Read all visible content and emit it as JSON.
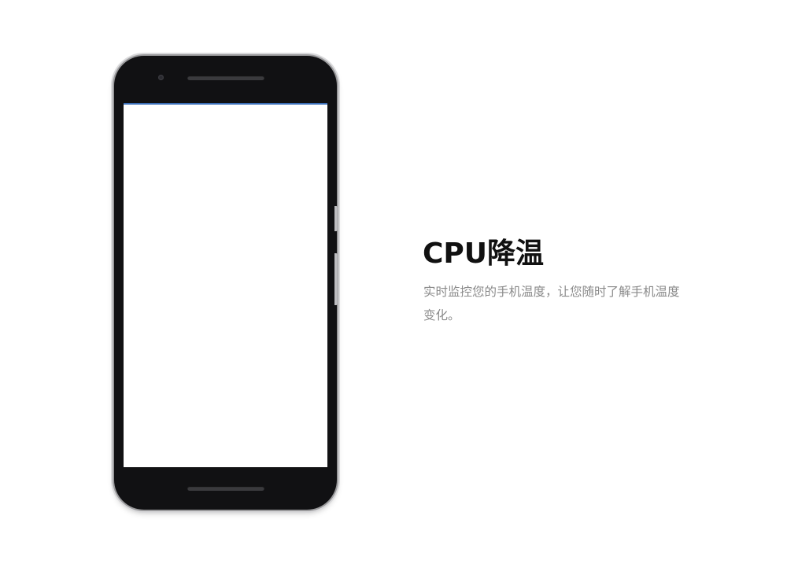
{
  "feature": {
    "title": "CPU降温",
    "description": "实时监控您的手机温度，让您随时了解手机温度变化。"
  },
  "device": {
    "screen_state": "blank"
  },
  "colors": {
    "background": "#ffffff",
    "phone_body": "#111113",
    "title_text": "#111111",
    "description_text": "#8a8a8a"
  }
}
